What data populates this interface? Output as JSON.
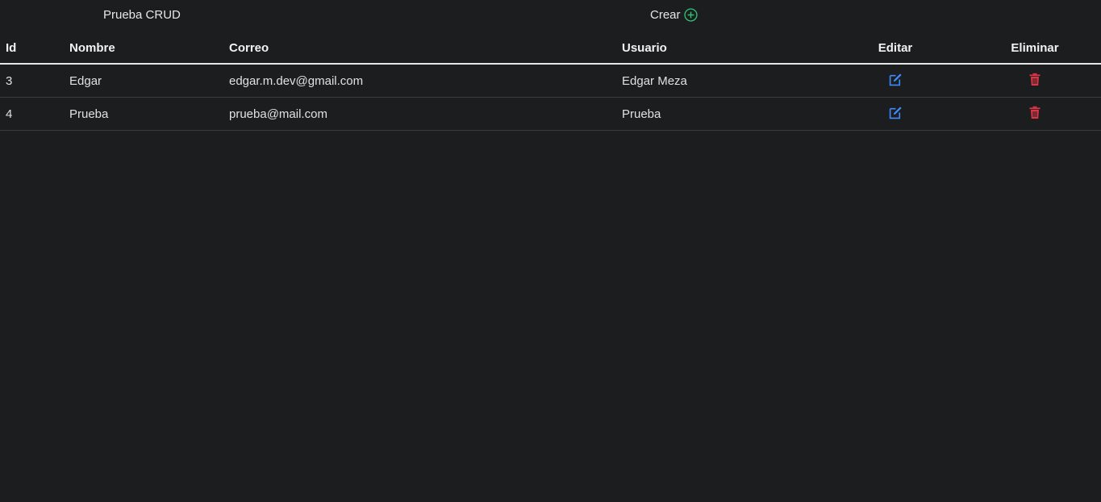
{
  "header": {
    "title": "Prueba CRUD",
    "create_label": "Crear",
    "create_icon": "plus-circle-icon"
  },
  "table": {
    "columns": [
      "Id",
      "Nombre",
      "Correo",
      "Usuario",
      "Editar",
      "Eliminar"
    ],
    "rows": [
      {
        "id": "3",
        "nombre": "Edgar",
        "correo": "edgar.m.dev@gmail.com",
        "usuario": "Edgar Meza"
      },
      {
        "id": "4",
        "nombre": "Prueba",
        "correo": "prueba@mail.com",
        "usuario": "Prueba"
      }
    ],
    "edit_icon": "edit-icon",
    "delete_icon": "trash-icon"
  },
  "colors": {
    "background": "#1b1d1f",
    "create_icon": "#2fbf71",
    "edit_icon": "#3d8bfd",
    "delete_icon": "#dc3545"
  }
}
